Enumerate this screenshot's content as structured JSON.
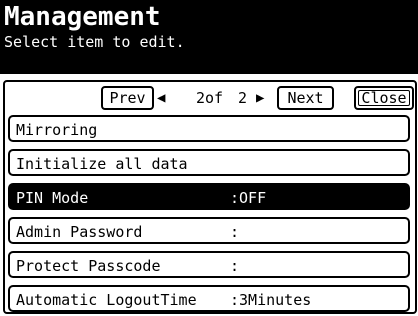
{
  "header": {
    "title": "Management",
    "subtitle": "Select item to edit."
  },
  "nav": {
    "prev_label": "Prev",
    "next_label": "Next",
    "close_label": "Close",
    "left_arrow": "◀",
    "right_arrow": "▶",
    "current_page": "2of",
    "total_pages": "2"
  },
  "items": [
    {
      "label": "Mirroring",
      "value": ""
    },
    {
      "label": "Initialize all data",
      "value": ""
    },
    {
      "label": "PIN Mode",
      "value": ":OFF"
    },
    {
      "label": "Admin Password",
      "value": ":"
    },
    {
      "label": "Protect Passcode",
      "value": ":"
    },
    {
      "label": "Automatic LogoutTime",
      "value": ":3Minutes"
    }
  ],
  "selected_index": 2
}
